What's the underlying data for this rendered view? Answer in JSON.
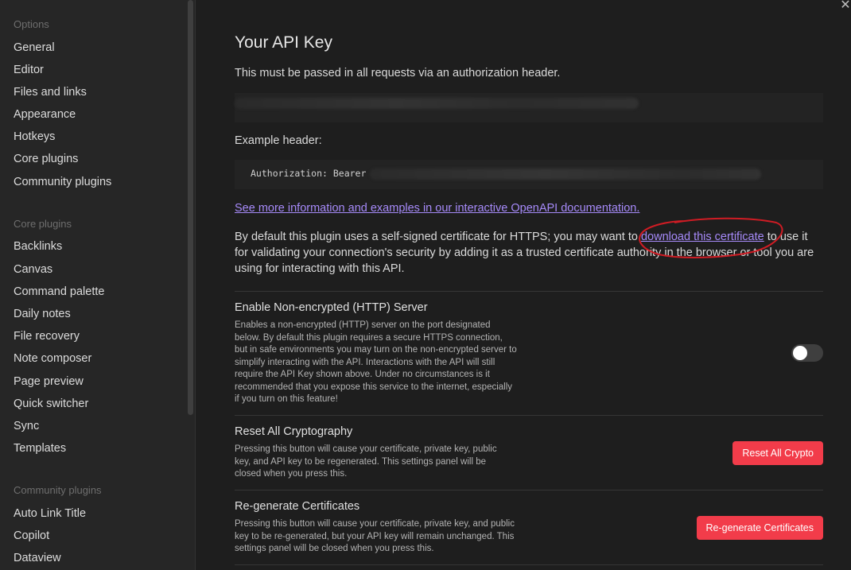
{
  "sidebar": {
    "options_header": "Options",
    "options": [
      "General",
      "Editor",
      "Files and links",
      "Appearance",
      "Hotkeys",
      "Core plugins",
      "Community plugins"
    ],
    "core_header": "Core plugins",
    "core": [
      "Backlinks",
      "Canvas",
      "Command palette",
      "Daily notes",
      "File recovery",
      "Note composer",
      "Page preview",
      "Quick switcher",
      "Sync",
      "Templates"
    ],
    "community_header": "Community plugins",
    "community": [
      "Auto Link Title",
      "Copilot",
      "Dataview"
    ]
  },
  "main": {
    "close_icon": "close-icon",
    "title": "Your API Key",
    "description": "This must be passed in all requests via an authorization header.",
    "example_header_label": "Example header:",
    "code_text": "Authorization: Bearer",
    "doc_link": "See more information and examples in our interactive OpenAPI documentation.",
    "cert_para_before": "By default this plugin uses a self-signed certificate for HTTPS; you may want to ",
    "cert_link": "download this certificate",
    "cert_para_after": " to use it for validating your connection's security by adding it as a trusted certificate authority in the browser or tool you are using for interacting with this API.",
    "settings": {
      "http": {
        "name": "Enable Non-encrypted (HTTP) Server",
        "desc": "Enables a non-encrypted (HTTP) server on the port designated below. By default this plugin requires a secure HTTPS connection, but in safe environments you may turn on the non-encrypted server to simplify interacting with the API. Interactions with the API will still require the API Key shown above. Under no circumstances is it recommended that you expose this service to the internet, especially if you turn on this feature!",
        "enabled": false
      },
      "reset": {
        "name": "Reset All Cryptography",
        "desc": "Pressing this button will cause your certificate, private key, public key, and API key to be regenerated. This settings panel will be closed when you press this.",
        "button": "Reset All Crypto"
      },
      "regen": {
        "name": "Re-generate Certificates",
        "desc": "Pressing this button will cause your certificate, private key, and public key to be re-generated, but your API key will remain unchanged. This settings panel will be closed when you press this.",
        "button": "Re-generate Certificates"
      }
    },
    "colors": {
      "accent": "#a68af9",
      "danger": "#f23c4a",
      "annotation": "#d01c24"
    }
  }
}
